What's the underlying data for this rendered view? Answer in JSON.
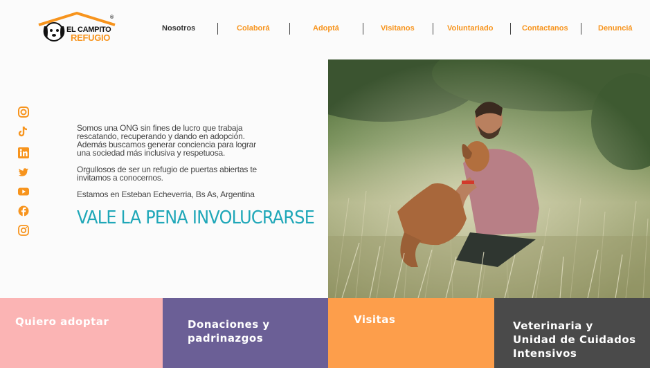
{
  "logo": {
    "line1": "EL CAMPITO",
    "line2": "REFUGIO",
    "registered": "®"
  },
  "nav": {
    "items": [
      {
        "label": "Nosotros"
      },
      {
        "label": "Colaborá"
      },
      {
        "label": "Adoptá"
      },
      {
        "label": "Visitanos"
      },
      {
        "label": "Voluntariado"
      },
      {
        "label": "Contactanos"
      },
      {
        "label": "Denunciá"
      }
    ]
  },
  "social": [
    "camera-icon",
    "tiktok-icon",
    "linkedin-icon",
    "twitter-icon",
    "youtube-icon",
    "facebook-icon",
    "instagram-icon"
  ],
  "intro": {
    "p1": "Somos una ONG sin fines de lucro que trabaja rescatando, recuperando y dando en adopción. Además buscamos generar conciencia para lograr una sociedad más inclusiva y respetuosa.",
    "p2": "Orgullosos de ser un refugio de puertas abiertas te invitamos a conocernos.",
    "p3": "Estamos en Esteban Echeverria, Bs As, Argentina",
    "tagline": "VALE LA PENA INVOLUCRARSE"
  },
  "tiles": {
    "t1": "Quiero adoptar",
    "t2": "Donaciones y padrinazgos",
    "t3": "Visitas",
    "t4": "Veterinaria y Unidad de Cuidados Intensivos"
  },
  "colors": {
    "accent": "#f7941d",
    "teal": "#1fa7b8",
    "pink": "#fbb4b4",
    "purple": "#6b5f96",
    "orange": "#fd9e4b",
    "dark": "#4a4a4a"
  }
}
